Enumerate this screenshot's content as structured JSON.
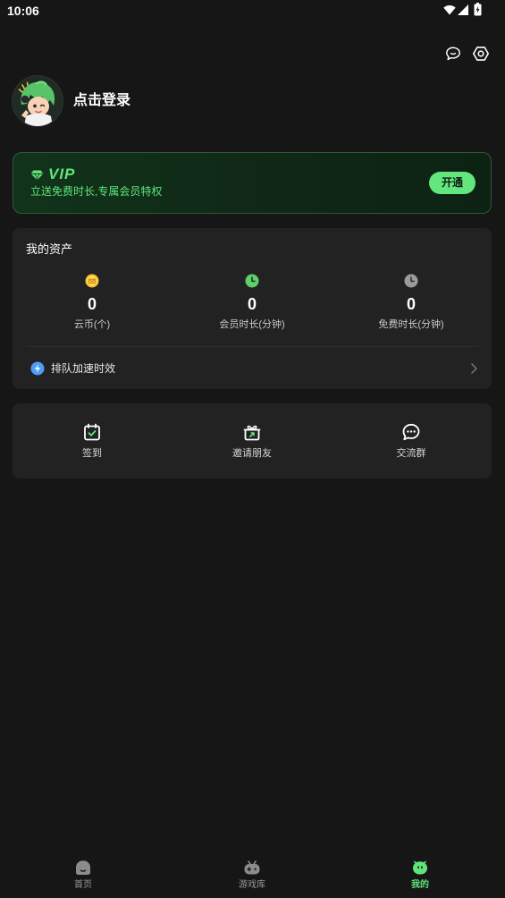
{
  "status_bar": {
    "time": "10:06",
    "icons": [
      "wifi-icon",
      "signal-icon",
      "battery-icon"
    ]
  },
  "header": {
    "icons": [
      "chat-icon",
      "settings-icon"
    ]
  },
  "profile": {
    "login_label": "点击登录"
  },
  "vip": {
    "badge": "VIP",
    "subtitle": "立送免费时长,专属会员特权",
    "button_label": "开通",
    "icon": "diamond-icon"
  },
  "assets": {
    "title": "我的资产",
    "items": [
      {
        "value": "0",
        "label": "云币(个)",
        "icon": "coin-icon"
      },
      {
        "value": "0",
        "label": "会员时长(分钟)",
        "icon": "clock-icon"
      },
      {
        "value": "0",
        "label": "免费时长(分钟)",
        "icon": "clock-icon"
      }
    ],
    "queue_label": "排队加速时效",
    "queue_icon": "lightning-icon"
  },
  "actions": [
    {
      "label": "签到",
      "icon": "calendar-check-icon"
    },
    {
      "label": "邀请朋友",
      "icon": "gift-icon"
    },
    {
      "label": "交流群",
      "icon": "chat-icon"
    }
  ],
  "bottom_nav": [
    {
      "label": "首页",
      "icon": "home-icon",
      "active": false
    },
    {
      "label": "游戏库",
      "icon": "gamepad-icon",
      "active": false
    },
    {
      "label": "我的",
      "icon": "mine-icon",
      "active": true
    }
  ],
  "colors": {
    "background": "#161616",
    "card": "#222222",
    "accent": "#5fe57a",
    "text": "#ffffff",
    "muted": "#c8c8c8"
  }
}
